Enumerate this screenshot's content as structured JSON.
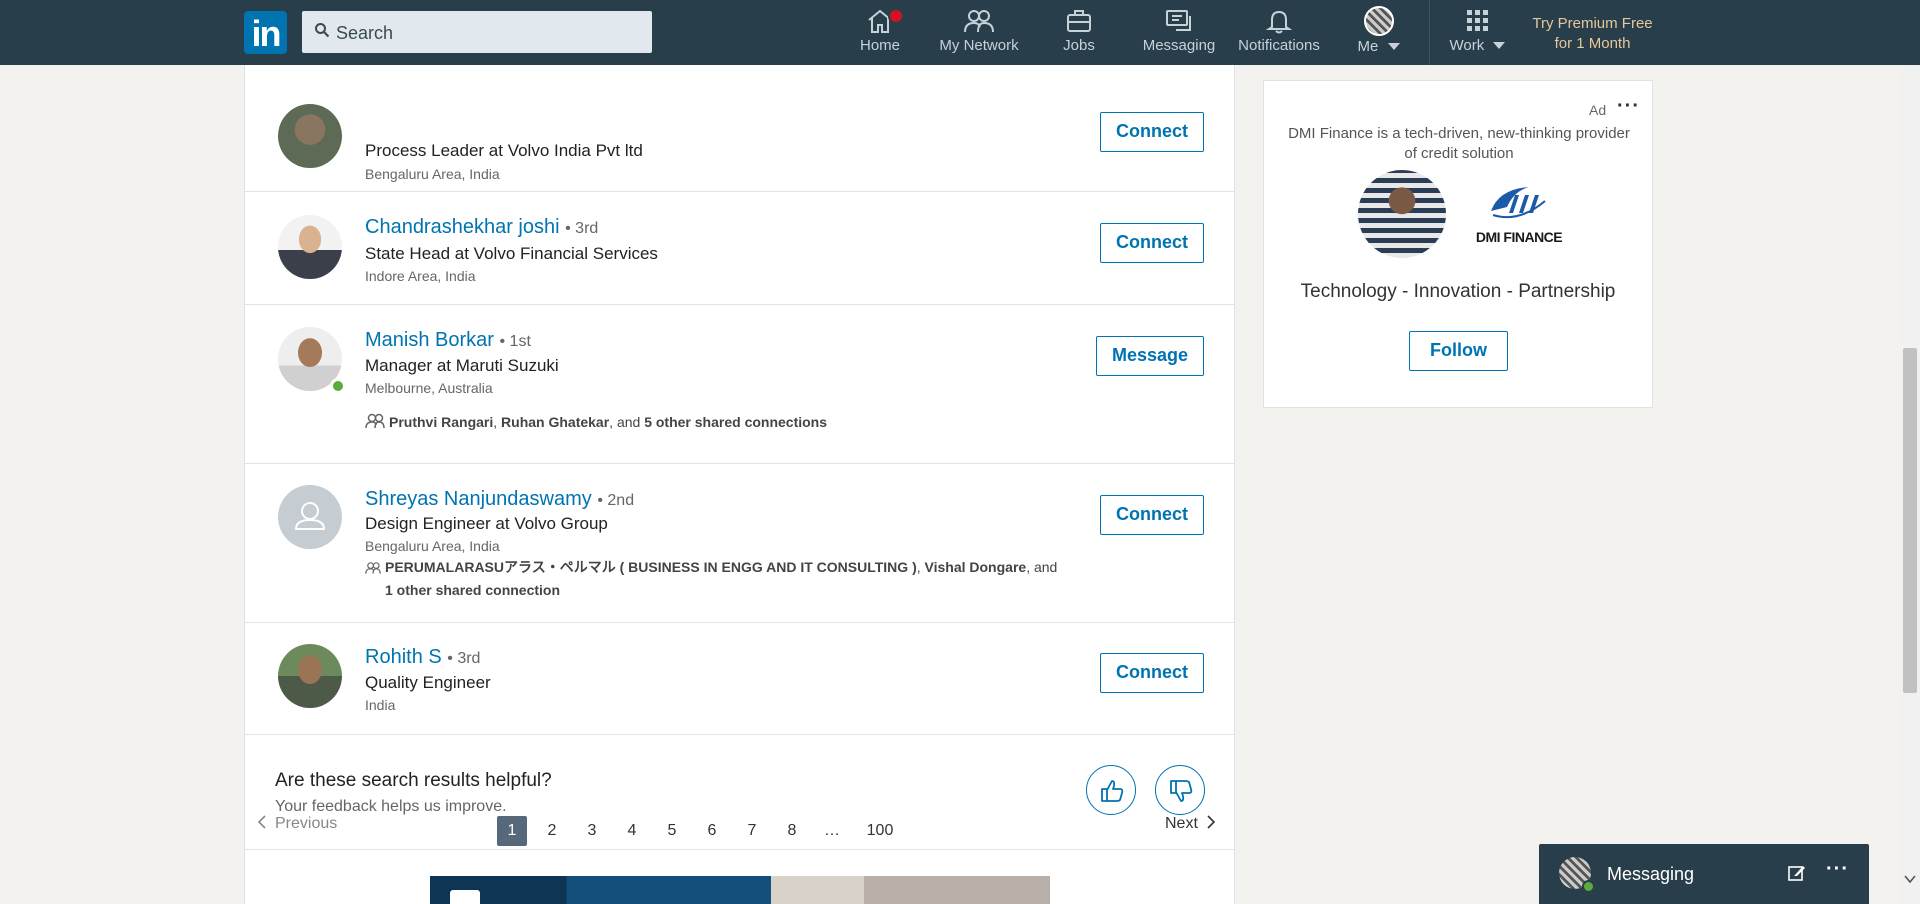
{
  "nav": {
    "search_placeholder": "Search",
    "home": "Home",
    "home_badge": "",
    "network": "My Network",
    "jobs": "Jobs",
    "messaging": "Messaging",
    "notifications": "Notifications",
    "me": "Me",
    "work": "Work",
    "premium_line1": "Try Premium Free",
    "premium_line2": "for 1 Month"
  },
  "results": [
    {
      "name": "",
      "degree": "",
      "title": "Process Leader at Volvo India Pvt ltd",
      "location": "Bengaluru Area, India",
      "action": "Connect"
    },
    {
      "name": "Chandrashekhar joshi",
      "degree": "• 3rd",
      "title": "State Head at Volvo Financial Services",
      "location": "Indore Area, India",
      "action": "Connect"
    },
    {
      "name": "Manish Borkar",
      "degree": "• 1st",
      "title": "Manager at Maruti Suzuki",
      "location": "Melbourne, Australia",
      "action": "Message",
      "shared_a": "Pruthvi Rangari",
      "shared_sep1": ", ",
      "shared_b": "Ruhan Ghatekar",
      "shared_sep2": ", and ",
      "shared_c": "5 other shared connections"
    },
    {
      "name": "Shreyas Nanjundaswamy",
      "degree": "• 2nd",
      "title": "Design Engineer at Volvo Group",
      "location": "Bengaluru Area, India",
      "action": "Connect",
      "shared_a": "PERUMALARASUアラス・ペルマル ( BUSINESS IN ENGG AND IT CONSULTING )",
      "shared_sep1": ", ",
      "shared_b": "Vishal Dongare",
      "shared_sep2": ", and",
      "shared_c": "1 other shared connection"
    },
    {
      "name": "Rohith S",
      "degree": "• 3rd",
      "title": "Quality Engineer",
      "location": "India",
      "action": "Connect"
    }
  ],
  "feedback": {
    "question": "Are these search results helpful?",
    "subtext": "Your feedback helps us improve."
  },
  "pagination": {
    "previous": "Previous",
    "next": "Next",
    "pages": [
      "1",
      "2",
      "3",
      "4",
      "5",
      "6",
      "7",
      "8",
      "…",
      "100"
    ],
    "current": "1"
  },
  "ad": {
    "label": "Ad",
    "more": "···",
    "text": "DMI Finance is a tech-driven, new-thinking provider of credit solution",
    "logo_text": "DMI FINANCE",
    "tagline": "Technology - Innovation - Partnership",
    "follow": "Follow"
  },
  "messaging_bar": {
    "label": "Messaging",
    "more": "···"
  },
  "colors": {
    "nav_bg": "#283e4a",
    "link_blue": "#0073b1",
    "premium_gold": "#e7c79b",
    "online_green": "#5bac3c",
    "badge_red": "#d11124"
  }
}
